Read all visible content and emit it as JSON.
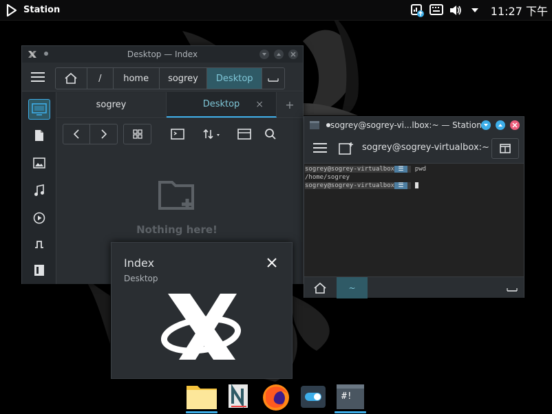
{
  "panel": {
    "app_name": "Station",
    "clock": "11:27 下午",
    "tray_icons": [
      "network-icon",
      "keyboard-icon",
      "volume-icon",
      "menu-arrow-icon"
    ]
  },
  "file_manager": {
    "title": "Desktop — Index",
    "breadcrumbs": [
      "/",
      "home",
      "sogrey",
      "Desktop"
    ],
    "tabs": [
      "sogrey",
      "Desktop"
    ],
    "tab_close": "×",
    "tab_add": "+",
    "empty_text": "Nothing here!",
    "sidebar_icons": [
      "desktop-icon",
      "document-icon",
      "image-icon",
      "music-icon",
      "video-icon",
      "downloads-icon",
      "panel-icon"
    ]
  },
  "terminal": {
    "title": "sogrey@sogrey-vi...lbox:~ — Station",
    "toolbar_label": "sogrey@sogrey-virtualbox:~",
    "lines": [
      {
        "prompt": "sogrey@sogrey-virtualbox",
        "cmd": " pwd"
      },
      {
        "output": "/home/sogrey"
      },
      {
        "prompt": "sogrey@sogrey-virtualbox",
        "cmd": " "
      }
    ],
    "tab_label": "~"
  },
  "popup": {
    "title": "Index",
    "subtitle": "Desktop"
  },
  "dock": {
    "items": [
      "files-icon",
      "notes-icon",
      "firefox-icon",
      "settings-toggle-icon",
      "terminal-icon"
    ],
    "terminal_text": "#!"
  }
}
